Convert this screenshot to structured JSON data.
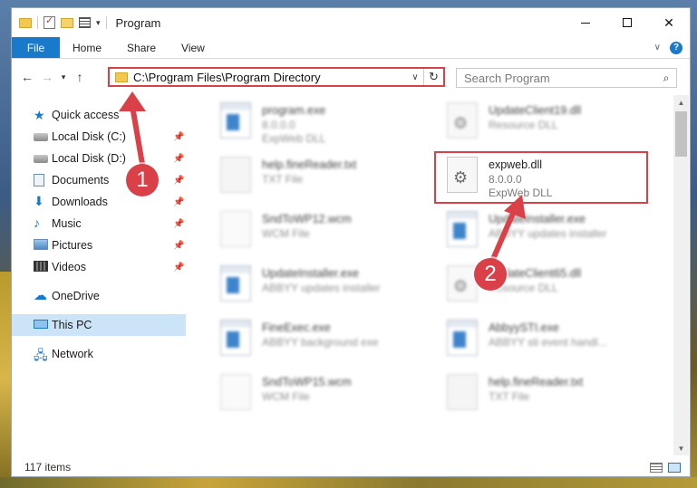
{
  "window": {
    "title": "Program"
  },
  "ribbon": {
    "tabs": [
      "File",
      "Home",
      "Share",
      "View"
    ],
    "help": "?"
  },
  "address": {
    "path": "C:\\Program Files\\Program Directory"
  },
  "search": {
    "placeholder": "Search Program"
  },
  "navpane": {
    "items": [
      {
        "label": "Quick access",
        "icon": "star-icon",
        "pinned": false
      },
      {
        "label": "Local Disk (C:)",
        "icon": "drive-icon",
        "pinned": true
      },
      {
        "label": "Local Disk (D:)",
        "icon": "drive-icon",
        "pinned": true
      },
      {
        "label": "Documents",
        "icon": "documents-icon",
        "pinned": true
      },
      {
        "label": "Downloads",
        "icon": "download-icon",
        "pinned": true
      },
      {
        "label": "Music",
        "icon": "music-icon",
        "pinned": true
      },
      {
        "label": "Pictures",
        "icon": "pictures-icon",
        "pinned": true
      },
      {
        "label": "Videos",
        "icon": "videos-icon",
        "pinned": true
      },
      {
        "label": "OneDrive",
        "icon": "cloud-icon",
        "pinned": false
      },
      {
        "label": "This PC",
        "icon": "computer-icon",
        "pinned": false,
        "selected": true
      },
      {
        "label": "Network",
        "icon": "network-icon",
        "pinned": false
      }
    ]
  },
  "files": [
    {
      "name": "program.exe",
      "line1": "8.0.0.0",
      "line2": "ExpWeb DLL",
      "icon": "exe-icon"
    },
    {
      "name": "UpdateClient19.dll",
      "line1": "Resource DLL",
      "line2": "",
      "icon": "dll-icon"
    },
    {
      "name": "help.fineReader.txt",
      "line1": "TXT File",
      "line2": "",
      "icon": "text-file-icon"
    },
    {
      "name": "expweb.dll",
      "line1": "8.0.0.0",
      "line2": "ExpWeb DLL",
      "icon": "dll-icon"
    },
    {
      "name": "SndToWP12.wcm",
      "line1": "WCM File",
      "line2": "",
      "icon": "wcm-file-icon"
    },
    {
      "name": "UpdateInstaller.exe",
      "line1": "ABBYY updates installer",
      "line2": "",
      "icon": "exe-icon"
    },
    {
      "name": "UpdateInstaller.exe",
      "line1": "ABBYY updates installer",
      "line2": "",
      "icon": "exe-icon"
    },
    {
      "name": "UpdateClient65.dll",
      "line1": "Resource DLL",
      "line2": "",
      "icon": "dll-icon"
    },
    {
      "name": "FineExec.exe",
      "line1": "ABBYY background exe",
      "line2": "",
      "icon": "exe-icon"
    },
    {
      "name": "AbbyySTI.exe",
      "line1": "ABBYY sti event handl...",
      "line2": "",
      "icon": "exe-icon"
    },
    {
      "name": "SndToWP15.wcm",
      "line1": "WCM File",
      "line2": "",
      "icon": "wcm-file-icon"
    },
    {
      "name": "help.fineReader.txt",
      "line1": "TXT File",
      "line2": "",
      "icon": "text-file-icon"
    }
  ],
  "markers": [
    "1",
    "2"
  ],
  "status": {
    "count": "117 items"
  },
  "colors": {
    "accent": "#1979ca",
    "highlight": "#d94047",
    "selection": "#cce4f7"
  }
}
